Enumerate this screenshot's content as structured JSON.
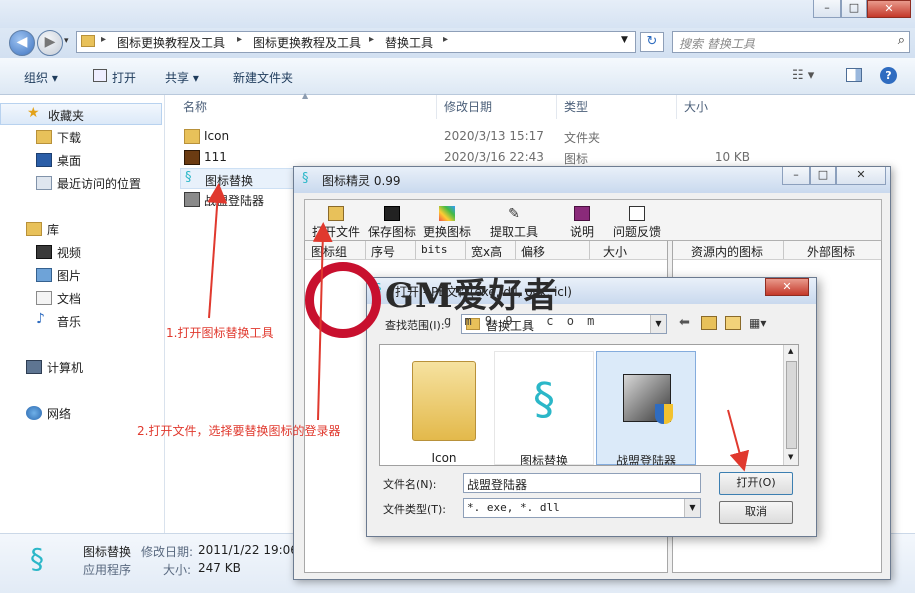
{
  "explorer": {
    "breadcrumb": [
      "图标更换教程及工具",
      "图标更换教程及工具",
      "替换工具"
    ],
    "search_placeholder": "搜索 替换工具",
    "toolbar": {
      "organize": "组织 ▾",
      "open": "打开",
      "share": "共享 ▾",
      "new_folder": "新建文件夹"
    },
    "sidebar": {
      "favorites": "收藏夹",
      "favorites_items": [
        "下载",
        "桌面",
        "最近访问的位置"
      ],
      "libraries": "库",
      "libraries_items": [
        "视频",
        "图片",
        "文档",
        "音乐"
      ],
      "computer": "计算机",
      "network": "网络"
    },
    "columns": {
      "name": "名称",
      "date": "修改日期",
      "type": "类型",
      "size": "大小"
    },
    "files": [
      {
        "name": "Icon",
        "date": "2020/3/13 15:17",
        "type": "文件夹",
        "size": ""
      },
      {
        "name": "111",
        "date": "2020/3/16 22:43",
        "type": "图标",
        "size": "10 KB"
      },
      {
        "name": "图标替换",
        "date": "",
        "type": "",
        "size": ""
      },
      {
        "name": "战盟登陆器",
        "date": "",
        "type": "",
        "size": ""
      }
    ],
    "details": {
      "name": "图标替换",
      "date_label": "修改日期:",
      "date": "2011/1/22 19:06",
      "kind": "应用程序",
      "size_label": "大小:",
      "size": "247 KB"
    }
  },
  "iconwin": {
    "title": "图标精灵 0.99",
    "tools": [
      "打开文件",
      "保存图标",
      "更换图标",
      "提取工具",
      "说明",
      "问题反馈"
    ],
    "grid_columns": [
      "图标组",
      "序号",
      "bits",
      "宽x高",
      "偏移",
      "大小"
    ],
    "right_columns": [
      "资源内的图标",
      "外部图标"
    ]
  },
  "opendlg": {
    "title": "打开 - PE文件(exe, dll, ocx, icl)",
    "lookin_label": "查找范围(I):",
    "lookin_value": "替换工具",
    "items": [
      "Icon",
      "图标替换",
      "战盟登陆器"
    ],
    "filename_label": "文件名(N):",
    "filename_value": "战盟登陆器",
    "filetype_label": "文件类型(T):",
    "filetype_value": "*. exe, *. dll",
    "open_button": "打开(O)",
    "cancel_button": "取消"
  },
  "annotations": {
    "step1": "1.打开图标替换工具",
    "step2": "2.打开文件，选择要替换图标的登录器"
  },
  "watermark": {
    "name": "GM爱好者",
    "url": "g m 9 9 . c o m"
  },
  "colors": {
    "accent": "#3f74c0",
    "annotation": "#e0392e",
    "logo": "#c8102e"
  }
}
